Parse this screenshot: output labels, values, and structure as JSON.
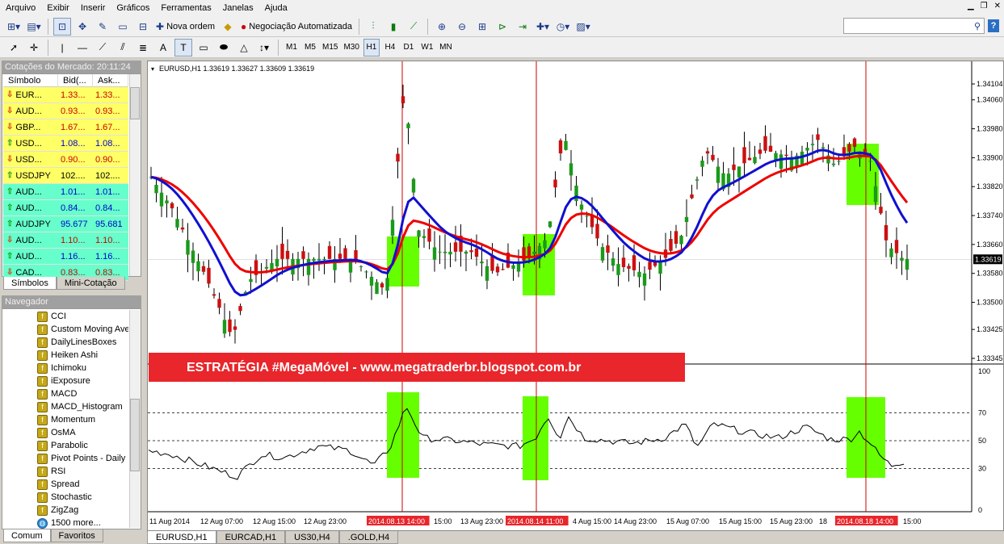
{
  "menu": [
    "Arquivo",
    "Exibir",
    "Inserir",
    "Gráficos",
    "Ferramentas",
    "Janelas",
    "Ajuda"
  ],
  "toolbar": {
    "new_order": "Nova ordem",
    "auto_trading": "Negociação Automatizada",
    "timeframes": [
      "M1",
      "M5",
      "M15",
      "M30",
      "H1",
      "H4",
      "D1",
      "W1",
      "MN"
    ],
    "active_tf": "H1",
    "search_icon": "search-icon",
    "help": "?"
  },
  "market_watch": {
    "title": "Cotações do Mercado: 20:11:24",
    "headers": [
      "Símbolo",
      "Bid(...",
      "Ask..."
    ],
    "rows": [
      {
        "symbol": "EUR...",
        "bid": "1.33...",
        "ask": "1.33...",
        "dir": "down",
        "bg": "#ffff66",
        "color": "#cc0000"
      },
      {
        "symbol": "AUD...",
        "bid": "0.93...",
        "ask": "0.93...",
        "dir": "down",
        "bg": "#ffff66",
        "color": "#cc0000"
      },
      {
        "symbol": "GBP...",
        "bid": "1.67...",
        "ask": "1.67...",
        "dir": "down",
        "bg": "#ffff66",
        "color": "#cc0000"
      },
      {
        "symbol": "USD...",
        "bid": "1.08...",
        "ask": "1.08...",
        "dir": "up",
        "bg": "#ffff66",
        "color": "#0000cc"
      },
      {
        "symbol": "USD...",
        "bid": "0.90...",
        "ask": "0.90...",
        "dir": "down",
        "bg": "#ffff66",
        "color": "#cc0000"
      },
      {
        "symbol": "USDJPY",
        "bid": "102....",
        "ask": "102....",
        "dir": "up",
        "bg": "#ffff66",
        "color": "#000000"
      },
      {
        "symbol": "AUD...",
        "bid": "1.01...",
        "ask": "1.01...",
        "dir": "up",
        "bg": "#66ffcc",
        "color": "#0000cc"
      },
      {
        "symbol": "AUD...",
        "bid": "0.84...",
        "ask": "0.84...",
        "dir": "up",
        "bg": "#66ffcc",
        "color": "#0000cc"
      },
      {
        "symbol": "AUDJPY",
        "bid": "95.677",
        "ask": "95.681",
        "dir": "up",
        "bg": "#66ffcc",
        "color": "#0000cc"
      },
      {
        "symbol": "AUD...",
        "bid": "1.10...",
        "ask": "1.10...",
        "dir": "down",
        "bg": "#66ffcc",
        "color": "#cc0000"
      },
      {
        "symbol": "AUD...",
        "bid": "1.16...",
        "ask": "1.16...",
        "dir": "up",
        "bg": "#66ffcc",
        "color": "#0000cc"
      },
      {
        "symbol": "CAD...",
        "bid": "0.83...",
        "ask": "0.83...",
        "dir": "down",
        "bg": "#66ffcc",
        "color": "#cc0000"
      }
    ],
    "tabs": [
      "Símbolos",
      "Mini-Cotação"
    ]
  },
  "navigator": {
    "title": "Navegador",
    "items": [
      "CCI",
      "Custom Moving Ave",
      "DailyLinesBoxes",
      "Heiken Ashi",
      "Ichimoku",
      "iExposure",
      "MACD",
      "MACD_Histogram",
      "Momentum",
      "OsMA",
      "Parabolic",
      "Pivot Points - Daily (",
      "RSI",
      "Spread",
      "Stochastic",
      "ZigZag",
      "1500 more..."
    ],
    "tabs": [
      "Comum",
      "Favoritos"
    ]
  },
  "chart": {
    "header": "EURUSD,H1  1.33619 1.33627 1.33609 1.33619",
    "current_price": "1.33619",
    "price_labels": [
      "1.34104",
      "1.34060",
      "1.33980",
      "1.33900",
      "1.33820",
      "1.33740",
      "1.33660",
      "1.33580",
      "1.33500",
      "1.33425",
      "1.33345"
    ],
    "rsi_labels": [
      "100",
      "70",
      "50",
      "30",
      "0"
    ],
    "banner": "ESTRATÉGIA #MegaMóvel - www.megatraderbr.blogspot.com.br",
    "time_labels": [
      "11 Aug 2014",
      "12 Aug 07:00",
      "12 Aug 15:00",
      "12 Aug 23:00",
      "2014.08.13 14:00",
      "15:00",
      "13 Aug 23:00",
      "2014.08.14 11:00",
      "4 Aug 15:00",
      "14 Aug 23:00",
      "15 Aug 07:00",
      "15 Aug 15:00",
      "15 Aug 23:00",
      "18",
      "2014.08.18 14:00",
      "15:00"
    ]
  },
  "bottom_tabs": [
    "EURUSD,H1",
    "EURCAD,H1",
    "US30,H4",
    ".GOLD,H4"
  ]
}
